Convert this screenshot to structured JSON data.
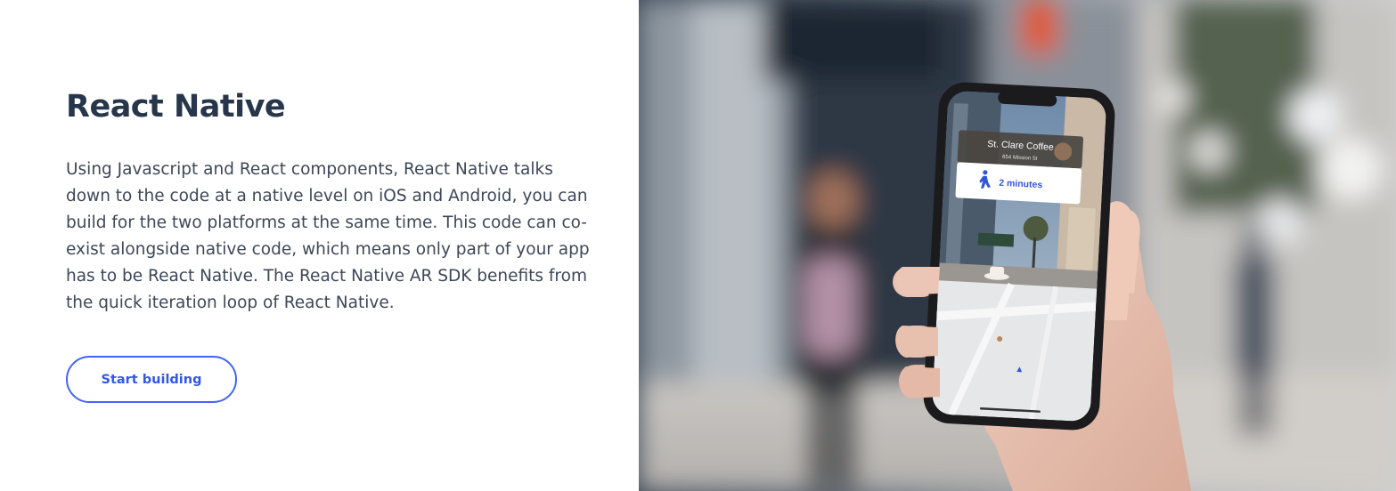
{
  "section": {
    "title": "React Native",
    "description": "Using Javascript and React components, React Native talks down to the code at a native level on iOS and Android, you can build for the two platforms at the same time. This code can co-exist alongside native code, which means only part of your app has to be React Native. The React Native AR SDK benefits from the quick iteration loop of React Native.",
    "cta_label": "Start building"
  },
  "photo": {
    "place_name": "St. Clare Coffee",
    "place_address": "654 Mission St",
    "walk_time": "2 minutes",
    "walk_icon": "walking-person-icon"
  },
  "colors": {
    "title": "#27364a",
    "body_text": "#3d4757",
    "button_border": "#4264fb",
    "button_text": "#3358e8"
  }
}
